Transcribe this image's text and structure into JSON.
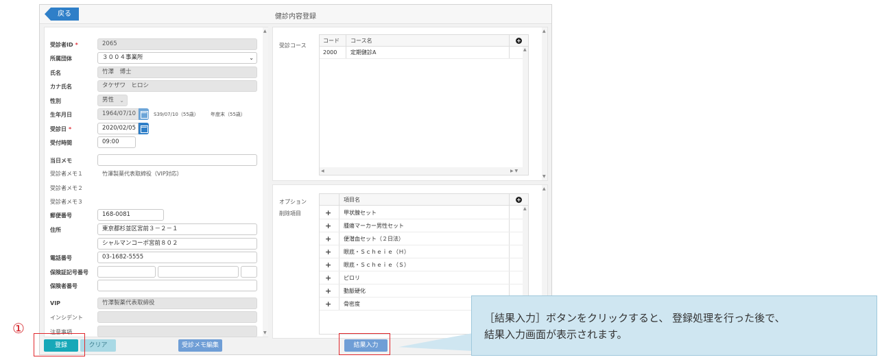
{
  "window": {
    "title": "健診内容登録",
    "back_label": "戻る"
  },
  "form": {
    "examinee_id": {
      "label": "受診者ID",
      "value": "2065"
    },
    "organization": {
      "label": "所属団体",
      "value": "３００４事業所"
    },
    "name": {
      "label": "氏名",
      "value": "竹澤　博士"
    },
    "kana_name": {
      "label": "カナ氏名",
      "value": "タケザワ　ヒロシ"
    },
    "gender": {
      "label": "性別",
      "value": "男性"
    },
    "birthdate": {
      "label": "生年月日",
      "value": "1964/07/10",
      "era_age": "S39/07/10（55歳）",
      "fiscal_age": "年度末（55歳）"
    },
    "exam_date": {
      "label": "受診日",
      "value": "2020/02/05"
    },
    "reception_time": {
      "label": "受付時間",
      "value": "09:00"
    },
    "day_memo": {
      "label": "当日メモ",
      "value": ""
    },
    "memo1": {
      "label": "受診者メモ１",
      "value": "竹澤製薬代表取締役（VIP対応）"
    },
    "memo2": {
      "label": "受診者メモ２",
      "value": ""
    },
    "memo3": {
      "label": "受診者メモ３",
      "value": ""
    },
    "postal_code": {
      "label": "郵便番号",
      "value": "168-0081"
    },
    "address": {
      "label": "住所",
      "line1": "東京都杉並区宮前３－２－１",
      "line2": "シャルマンコーポ宮前８０２"
    },
    "phone": {
      "label": "電話番号",
      "value": "03-1682-5555"
    },
    "insurance_card_no": {
      "label": "保険証記号番号"
    },
    "insurer_no": {
      "label": "保険者番号"
    },
    "vip": {
      "label": "VIP",
      "value": "竹澤製薬代表取締役"
    },
    "incident": {
      "label": "インシデント",
      "value": ""
    },
    "notes": {
      "label": "注意事項",
      "value": ""
    },
    "required_mark": "*"
  },
  "courses": {
    "label": "受診コース",
    "columns": [
      "コード",
      "コース名"
    ],
    "rows": [
      {
        "code": "2000",
        "name": "定期健診A"
      }
    ]
  },
  "options": {
    "label": "オプション",
    "sub_label": "削除項目",
    "column": "項目名",
    "items": [
      "甲状腺セット",
      "腫瘍マーカー男性セット",
      "便潜血セット（２日法）",
      "眼底・Ｓｃｈｅｉｅ（Ｈ）",
      "眼底・Ｓｃｈｅｉｅ（Ｓ）",
      "ピロリ",
      "動脈硬化",
      "骨密度"
    ]
  },
  "buttons": {
    "register": "登録",
    "clear": "クリア",
    "memo_edit": "受診メモ編集",
    "result_input": "結果入力"
  },
  "annotation": {
    "number": "①",
    "line1": "［結果入力］ボタンをクリックすると、 登録処理を行った後で、",
    "line2": "結果入力画面が表示されます。"
  },
  "colors": {
    "primary": "#2f7fc8",
    "teal": "#17a8b8",
    "highlight": "#e0262b",
    "tooltip_bg": "#cfe6f1"
  }
}
